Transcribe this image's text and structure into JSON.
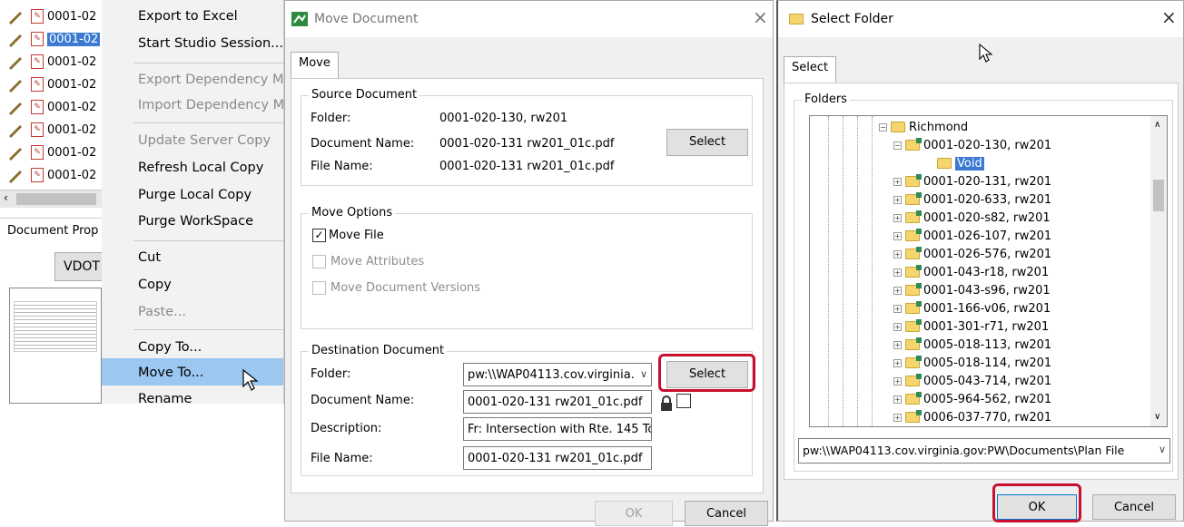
{
  "files": [
    {
      "label": "0001-02",
      "selected": false
    },
    {
      "label": "0001-02",
      "selected": true
    },
    {
      "label": "0001-02",
      "selected": false
    },
    {
      "label": "0001-02",
      "selected": false
    },
    {
      "label": "0001-02",
      "selected": false
    },
    {
      "label": "0001-02",
      "selected": false
    },
    {
      "label": "0001-02",
      "selected": false
    },
    {
      "label": "0001-02",
      "selected": false
    }
  ],
  "doc_props": {
    "label": "Document Prop",
    "button": "VDOT"
  },
  "context_menu": {
    "items": [
      {
        "label": "Export to Excel",
        "disabled": false
      },
      {
        "label": "Start Studio Session...",
        "disabled": false
      },
      {
        "label": "Export Dependency M",
        "disabled": true
      },
      {
        "label": "Import Dependency M",
        "disabled": true
      },
      {
        "label": "Update Server Copy",
        "disabled": true
      },
      {
        "label": "Refresh Local Copy",
        "disabled": false
      },
      {
        "label": "Purge Local Copy",
        "disabled": false
      },
      {
        "label": "Purge WorkSpace",
        "disabled": false
      },
      {
        "label": "Cut",
        "disabled": false
      },
      {
        "label": "Copy",
        "disabled": false
      },
      {
        "label": "Paste...",
        "disabled": true
      },
      {
        "label": "Copy To...",
        "disabled": false
      },
      {
        "label": "Move To...",
        "disabled": false
      },
      {
        "label": "Rename",
        "disabled": false
      }
    ]
  },
  "move_dialog": {
    "title": "Move Document",
    "tab": "Move",
    "source": {
      "group": "Source Document",
      "folder_label": "Folder:",
      "folder_value": "0001-020-130, rw201",
      "docname_label": "Document Name:",
      "docname_value": "0001-020-131 rw201_01c.pdf",
      "filename_label": "File Name:",
      "filename_value": "0001-020-131 rw201_01c.pdf",
      "select": "Select"
    },
    "options": {
      "group": "Move Options",
      "move_file": "Move File",
      "move_attributes": "Move Attributes",
      "move_versions": "Move Document Versions"
    },
    "destination": {
      "group": "Destination Document",
      "folder_label": "Folder:",
      "folder_value": "pw:\\\\WAP04113.cov.virginia.",
      "select": "Select",
      "docname_label": "Document Name:",
      "docname_value": "0001-020-131 rw201_01c.pdf",
      "desc_label": "Description:",
      "desc_value": "Fr: Intersection with Rte. 145 To",
      "filename_label": "File Name:",
      "filename_value": "0001-020-131 rw201_01c.pdf"
    },
    "ok": "OK",
    "cancel": "Cancel"
  },
  "select_folder": {
    "title": "Select Folder",
    "tab": "Select",
    "group": "Folders",
    "tree": [
      {
        "label": "Richmond",
        "level": 0,
        "expanded": true
      },
      {
        "label": "0001-020-130, rw201",
        "level": 1,
        "expanded": true
      },
      {
        "label": "Void",
        "level": 2,
        "selected": true
      },
      {
        "label": "0001-020-131, rw201",
        "level": 1
      },
      {
        "label": "0001-020-633, rw201",
        "level": 1
      },
      {
        "label": "0001-020-s82, rw201",
        "level": 1
      },
      {
        "label": "0001-026-107, rw201",
        "level": 1
      },
      {
        "label": "0001-026-576, rw201",
        "level": 1
      },
      {
        "label": "0001-043-r18, rw201",
        "level": 1
      },
      {
        "label": "0001-043-s96, rw201",
        "level": 1
      },
      {
        "label": "0001-166-v06, rw201",
        "level": 1
      },
      {
        "label": "0001-301-r71, rw201",
        "level": 1
      },
      {
        "label": "0005-018-113, rw201",
        "level": 1
      },
      {
        "label": "0005-018-114, rw201",
        "level": 1
      },
      {
        "label": "0005-043-714, rw201",
        "level": 1
      },
      {
        "label": "0005-964-562, rw201",
        "level": 1
      },
      {
        "label": "0006-037-770, rw201",
        "level": 1
      }
    ],
    "path": "pw:\\\\WAP04113.cov.virginia.gov:PW\\Documents\\Plan File",
    "ok": "OK",
    "cancel": "Cancel"
  }
}
